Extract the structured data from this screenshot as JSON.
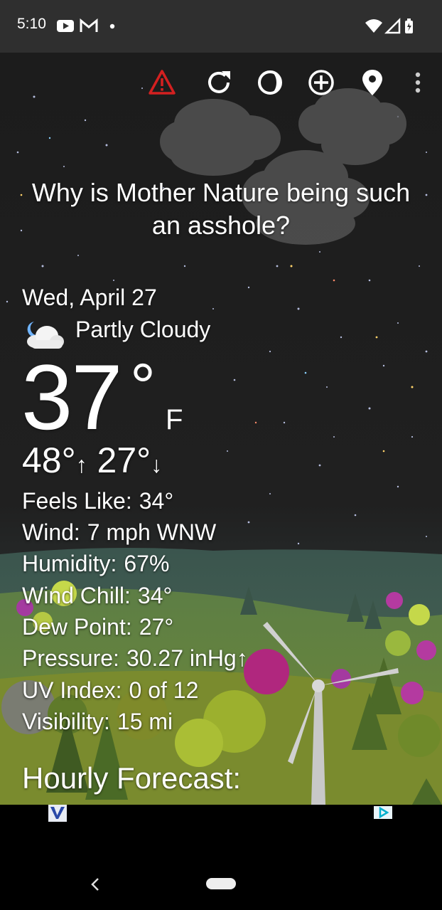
{
  "status_bar": {
    "time": "5:10"
  },
  "toolbar": {
    "icons": [
      "warning-icon",
      "refresh-icon",
      "theme-icon",
      "add-location-icon",
      "location-pin-icon",
      "more-vert-icon"
    ],
    "warning_color": "#d32020"
  },
  "quote": "Why is Mother Nature being such an asshole?",
  "weather": {
    "date": "Wed, April 27",
    "condition": "Partly Cloudy",
    "temperature": "37",
    "degree": "°",
    "unit": "F",
    "high": "48°",
    "high_arrow": "↑",
    "low": "27°",
    "low_arrow": "↓"
  },
  "details": [
    {
      "label": "Feels Like:",
      "value": "34°"
    },
    {
      "label": "Wind:",
      "value": "7 mph WNW"
    },
    {
      "label": "Humidity:",
      "value": "67%"
    },
    {
      "label": "Wind Chill:",
      "value": "34°"
    },
    {
      "label": "Dew Point:",
      "value": "27°"
    },
    {
      "label": "Pressure:",
      "value": "30.27 inHg↑"
    },
    {
      "label": "UV Index:",
      "value": "0 of 12"
    },
    {
      "label": "Visibility:",
      "value": "15 mi"
    }
  ],
  "hourly_title": "Hourly Forecast:"
}
